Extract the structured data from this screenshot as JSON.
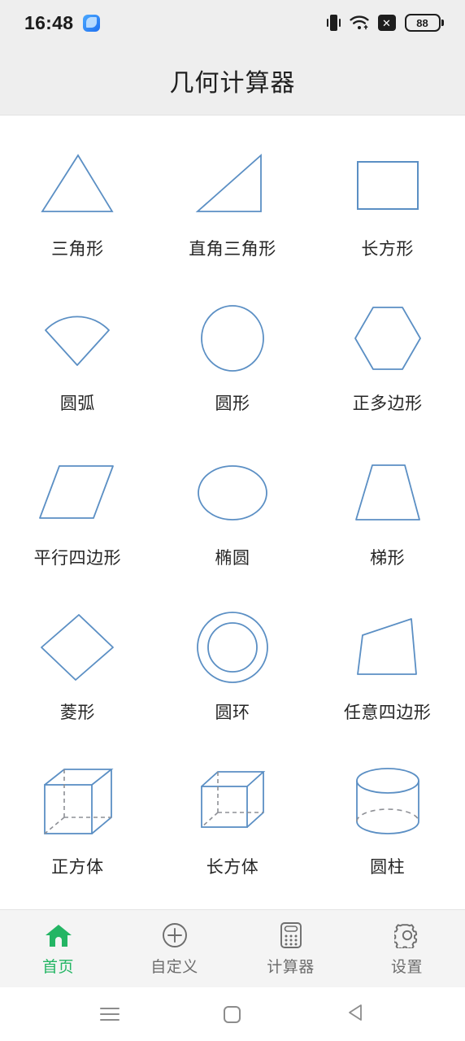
{
  "status_bar": {
    "time": "16:48",
    "app_icon": "app-badge-icon",
    "vibrate_icon": "vibrate-icon",
    "wifi_icon": "wifi-icon",
    "x_icon": "x-icon",
    "battery_level": "88"
  },
  "header": {
    "title": "几何计算器"
  },
  "shapes": [
    {
      "label": "三角形",
      "icon": "triangle-shape"
    },
    {
      "label": "直角三角形",
      "icon": "right-triangle-shape"
    },
    {
      "label": "长方形",
      "icon": "rectangle-shape"
    },
    {
      "label": "圆弧",
      "icon": "arc-sector-shape"
    },
    {
      "label": "圆形",
      "icon": "circle-shape"
    },
    {
      "label": "正多边形",
      "icon": "regular-polygon-shape"
    },
    {
      "label": "平行四边形",
      "icon": "parallelogram-shape"
    },
    {
      "label": "椭圆",
      "icon": "ellipse-shape"
    },
    {
      "label": "梯形",
      "icon": "trapezoid-shape"
    },
    {
      "label": "菱形",
      "icon": "rhombus-shape"
    },
    {
      "label": "圆环",
      "icon": "annulus-shape"
    },
    {
      "label": "任意四边形",
      "icon": "quadrilateral-shape"
    },
    {
      "label": "正方体",
      "icon": "cube-shape"
    },
    {
      "label": "长方体",
      "icon": "cuboid-shape"
    },
    {
      "label": "圆柱",
      "icon": "cylinder-shape"
    }
  ],
  "tabbar": {
    "items": [
      {
        "label": "首页",
        "icon": "home-icon",
        "active": true
      },
      {
        "label": "自定义",
        "icon": "plus-circle-icon",
        "active": false
      },
      {
        "label": "计算器",
        "icon": "calculator-icon",
        "active": false
      },
      {
        "label": "设置",
        "icon": "gear-icon",
        "active": false
      }
    ]
  },
  "system_nav": {
    "recents_icon": "menu-icon",
    "home_icon": "square-icon",
    "back_icon": "back-triangle-icon"
  },
  "colors": {
    "shape_stroke": "#5b8fc4",
    "active_tab": "#24b564",
    "inactive_tab": "#6d6d6d",
    "header_bg": "#eeeeee",
    "tabbar_bg": "#f4f4f4"
  }
}
